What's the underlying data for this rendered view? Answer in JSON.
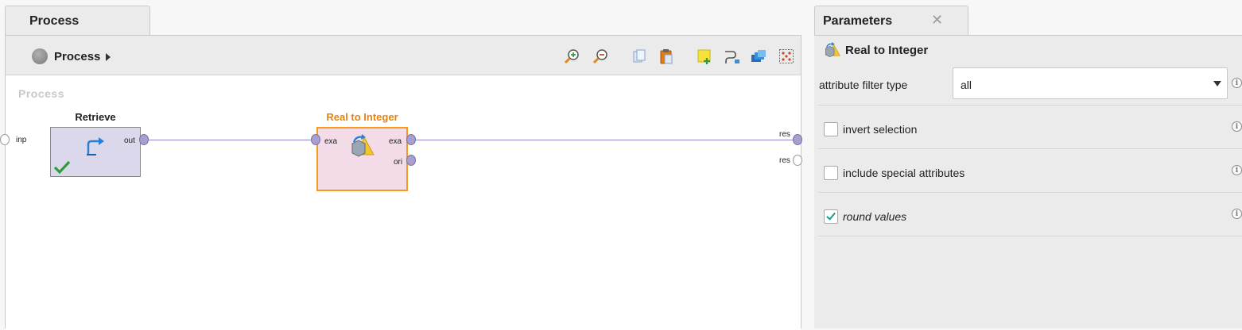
{
  "process_tab": {
    "label": "Process"
  },
  "breadcrumb": {
    "label": "Process"
  },
  "toolbar": {
    "buttons": [
      "zoom-in-icon",
      "zoom-out-icon",
      "copy-icon",
      "paste-icon",
      "add-note-icon",
      "auto-wire-icon",
      "layers-icon",
      "arrange-icon"
    ]
  },
  "canvas": {
    "title": "Process",
    "process_input_port": "inp",
    "result_ports": [
      "res",
      "res"
    ],
    "operators": [
      {
        "name": "Retrieve",
        "ports_out": [
          "out"
        ],
        "status": "executed"
      },
      {
        "name": "Real to Integer",
        "ports_in": [
          "exa"
        ],
        "ports_out": [
          "exa",
          "ori"
        ],
        "selected": true
      }
    ]
  },
  "parameters": {
    "tab_label": "Parameters",
    "operator_name": "Real to Integer",
    "attribute_filter_type": {
      "label": "attribute filter type",
      "value": "all"
    },
    "invert_selection": {
      "label": "invert selection",
      "checked": false
    },
    "include_special_attributes": {
      "label": "include special attributes",
      "checked": false
    },
    "round_values": {
      "label": "round values",
      "checked": true
    }
  },
  "colors": {
    "wire": "#8f87c9",
    "selected_operator_border": "#f59a23",
    "selected_operator_title": "#e8820e",
    "retrieve_fill": "#dcd8eb",
    "real_to_int_fill": "#f3dbe8",
    "check_green": "#2e9c3c"
  }
}
